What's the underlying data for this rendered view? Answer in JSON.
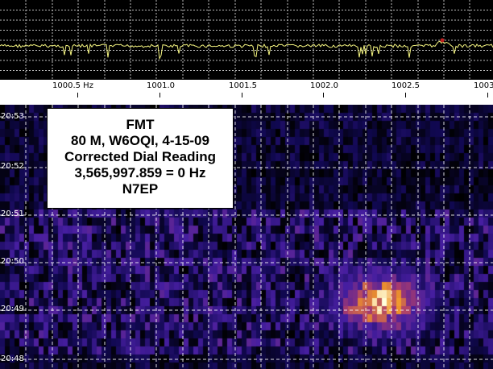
{
  "frequency_axis": {
    "unit_label": "1000.5 Hz",
    "ticks": [
      "1001.0",
      "1001.5",
      "1002.0",
      "1002.5",
      "1003"
    ]
  },
  "time_axis": {
    "labels": [
      "20:53",
      "20:52",
      "20:51",
      "20:50",
      "20:49",
      "20:48"
    ]
  },
  "info_box": {
    "lines": [
      "FMT",
      "80 M, W6OQI, 4-15-09",
      "Corrected Dial Reading",
      "3,565,997.859 = 0 Hz",
      "N7EP"
    ]
  },
  "colors": {
    "trace": "#f5f580",
    "peak_marker": "#c02020",
    "grid": "#ffffff",
    "waterfall_low": "#1a0a6e",
    "waterfall_high": "#ffffff"
  }
}
